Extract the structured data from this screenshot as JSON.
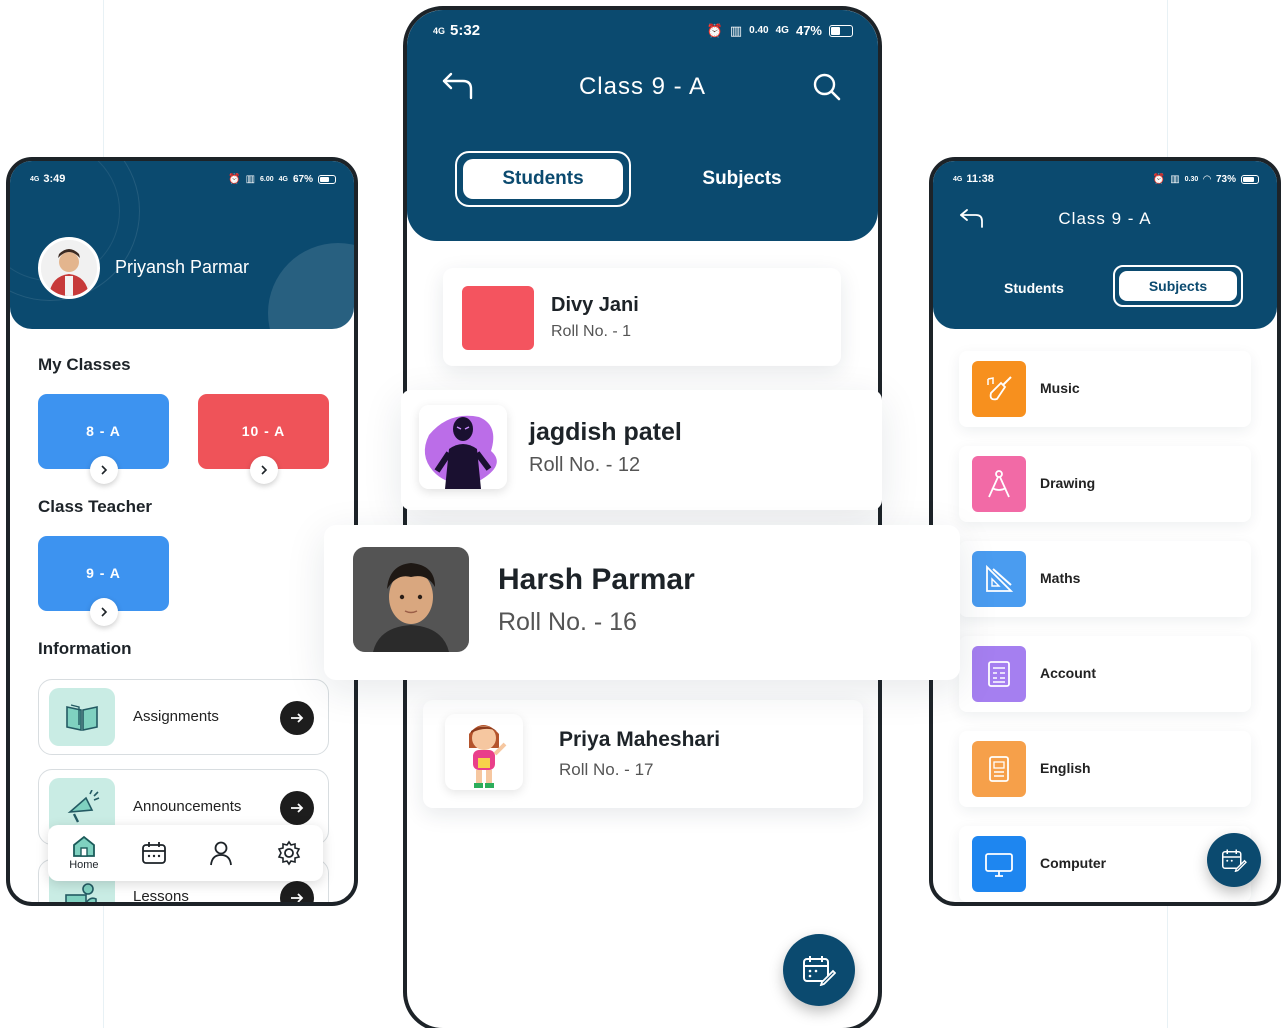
{
  "colors": {
    "brand": "#0b4a6f",
    "blue_card": "#3d93f0",
    "red_card": "#ef5359",
    "teal_icon_bg": "#c9ece4"
  },
  "left_phone": {
    "status": {
      "time": "3:49",
      "network": "4G",
      "data_rate": "6.00",
      "signal_text": "4G",
      "battery": "67%"
    },
    "user_name": "Priyansh Parmar",
    "my_classes_title": "My Classes",
    "my_classes": [
      {
        "label": "8 - A",
        "color": "#3d93f0"
      },
      {
        "label": "10 - A",
        "color": "#ef5359"
      }
    ],
    "class_teacher_title": "Class Teacher",
    "class_teacher": [
      {
        "label": "9 - A",
        "color": "#3d93f0"
      }
    ],
    "information_title": "Information",
    "information": [
      {
        "label": "Assignments",
        "icon": "book-icon"
      },
      {
        "label": "Announcements",
        "icon": "megaphone-icon"
      },
      {
        "label": "Lessons",
        "icon": "teacher-icon"
      }
    ],
    "bottom_nav": [
      {
        "label": "Home",
        "icon": "home-icon"
      },
      {
        "label": "",
        "icon": "calendar-icon"
      },
      {
        "label": "",
        "icon": "user-icon"
      },
      {
        "label": "",
        "icon": "gear-icon"
      }
    ]
  },
  "center_phone": {
    "status": {
      "time": "5:32",
      "network": "4G",
      "data_rate": "0.40",
      "signal_text": "4G",
      "battery": "47%"
    },
    "title": "Class 9 - A",
    "tabs": {
      "students": "Students",
      "subjects": "Subjects",
      "active": "students"
    },
    "students": [
      {
        "name": "Divy Jani",
        "roll": "Roll No. - 1",
        "avatar_color": "#f4545f"
      },
      {
        "name": "jagdish patel",
        "roll": "Roll No. - 12",
        "avatar": "purple-character"
      },
      {
        "name": "Harsh Parmar",
        "roll": "Roll No. - 16",
        "avatar": "photo-portrait"
      },
      {
        "name": "Priya Maheshari",
        "roll": "Roll No. - 17",
        "avatar": "cartoon-girl"
      }
    ]
  },
  "right_phone": {
    "status": {
      "time": "11:38",
      "network": "4G",
      "data_rate": "0.30",
      "battery": "73%"
    },
    "title": "Class 9 - A",
    "tabs": {
      "students": "Students",
      "subjects": "Subjects",
      "active": "subjects"
    },
    "subjects": [
      {
        "label": "Music",
        "icon": "guitar-icon",
        "color": "#f7901e"
      },
      {
        "label": "Drawing",
        "icon": "compass-icon",
        "color": "#f26aa6"
      },
      {
        "label": "Maths",
        "icon": "ruler-icon",
        "color": "#4a9cf0"
      },
      {
        "label": "Account",
        "icon": "ledger-icon",
        "color": "#a57ff0"
      },
      {
        "label": "English",
        "icon": "eng-book-icon",
        "color": "#f6a04a"
      },
      {
        "label": "Computer",
        "icon": "monitor-icon",
        "color": "#1e86f0"
      }
    ]
  }
}
